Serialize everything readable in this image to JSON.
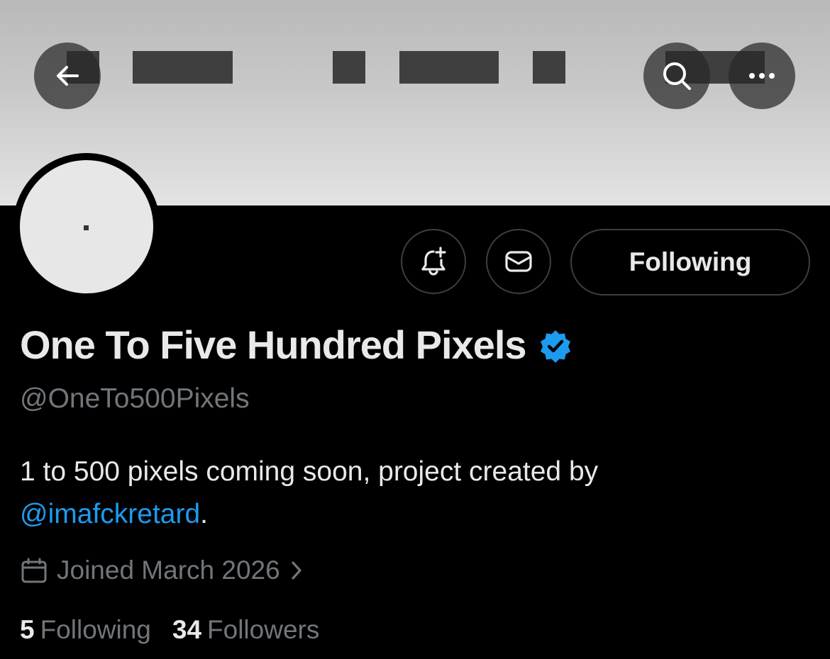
{
  "header": {
    "back_icon": "arrow-left-icon",
    "search_icon": "search-icon",
    "more_icon": "more-horizontal-icon",
    "banner_colors": [
      "#b9b9b9",
      "#e3e3e3"
    ]
  },
  "avatar": {
    "background": "#e6e7e6"
  },
  "actions": {
    "notify_icon": "bell-plus-icon",
    "message_icon": "envelope-icon",
    "following_label": "Following"
  },
  "profile": {
    "display_name": "One To Five Hundred Pixels",
    "verified_icon": "verified-badge-icon",
    "handle": "@OneTo500Pixels",
    "bio_text": "1 to 500 pixels coming soon, project created by ",
    "bio_mention": "@imafckretard",
    "bio_suffix": ".",
    "joined_icon": "calendar-icon",
    "joined": "Joined March 2026",
    "joined_chevron_icon": "chevron-right-icon"
  },
  "stats": {
    "following_count": "5",
    "following_label": "Following",
    "followers_count": "34",
    "followers_label": "Followers"
  },
  "colors": {
    "accent": "#1d9bf0",
    "text_primary": "#e7e9ea",
    "text_secondary": "#71767b",
    "background": "#000000"
  }
}
